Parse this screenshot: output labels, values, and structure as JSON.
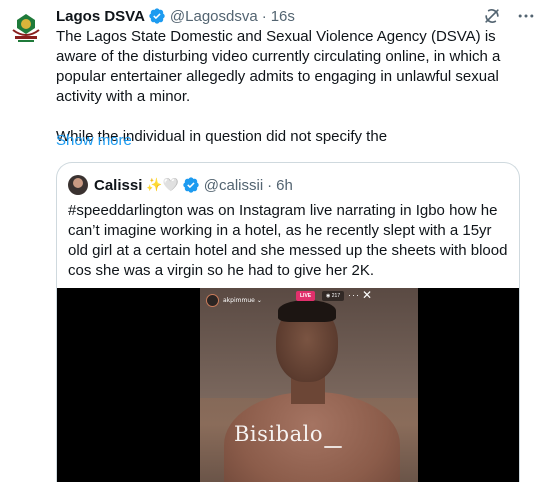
{
  "tweet": {
    "author_name": "Lagos DSVA",
    "author_handle": "@Lagosdsva",
    "separator": "·",
    "time": "16s",
    "paragraphs": [
      "The Lagos State Domestic and Sexual Violence Agency (DSVA) is aware of the disturbing video currently circulating online, in which a popular entertainer allegedly admits to engaging in unlawful sexual activity with a minor.",
      "While the individual in question did not specify the"
    ],
    "show_more": "Show more",
    "icons": [
      "verified-badge-icon",
      "grok-icon",
      "more-icon"
    ]
  },
  "quote": {
    "author_name": "Calissi",
    "author_emoji": "✨🤍",
    "author_handle": "@calissii",
    "separator": "·",
    "time": "6h",
    "text": "#speeddarlington was on Instagram live narrating in Igbo how he can’t imagine working in a hotel, as he recently slept with a 15yr old girl at a certain hotel and she messed up the sheets with blood cos she was a virgin so he had to give her 2K.",
    "media": {
      "live_username": "akpimmue",
      "live_badge": "LIVE",
      "viewer_count": "217",
      "watermark": "Bisibalo"
    }
  },
  "colors": {
    "link": "#1d9bf0",
    "verified": "#1d9bf0",
    "muted": "#536471",
    "text": "#0f1419",
    "border": "#cfd9de"
  }
}
